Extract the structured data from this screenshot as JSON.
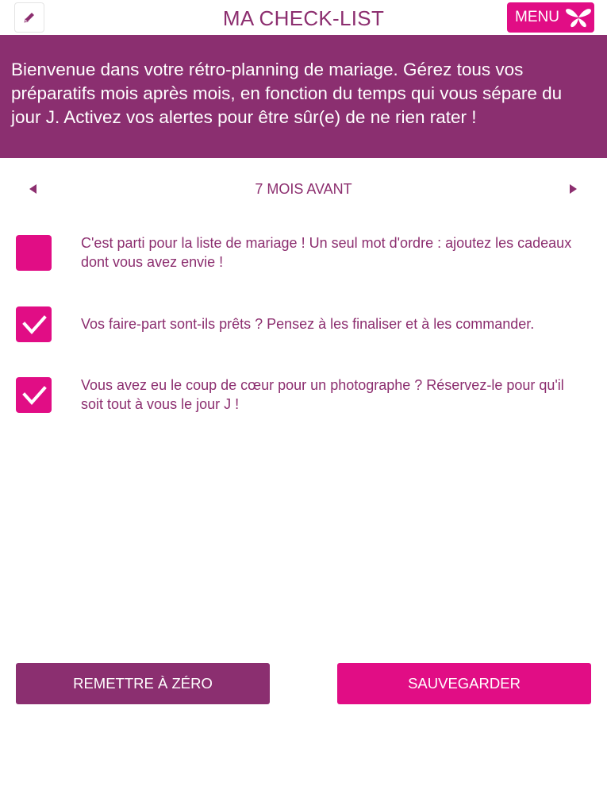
{
  "header": {
    "title": "MA CHECK-LIST",
    "menu_label": "MENU",
    "edit_icon": "pencil-icon",
    "menu_icon": "butterfly-icon"
  },
  "banner": {
    "text": "Bienvenue dans votre rétro-planning de mariage. Gérez tous vos préparatifs mois après mois, en fonction du temps qui vous sépare du jour J. Activez vos alertes pour être sûr(e) de ne rien rater !"
  },
  "month_nav": {
    "label": "7 MOIS AVANT",
    "prev_icon": "triangle-left-icon",
    "next_icon": "triangle-right-icon"
  },
  "tasks": [
    {
      "text": "C'est parti pour la liste de mariage ! Un seul mot d'ordre : ajoutez les cadeaux dont vous avez envie !",
      "checked": false
    },
    {
      "text": "Vos faire-part sont-ils prêts ? Pensez à les finaliser et à les commander.",
      "checked": true
    },
    {
      "text": "Vous avez eu le coup de cœur pour un photographe ? Réservez-le pour qu'il soit tout à vous le jour J !",
      "checked": true
    }
  ],
  "actions": {
    "reset_label": "REMETTRE À ZÉRO",
    "save_label": "SAUVEGARDER"
  },
  "colors": {
    "brand_purple": "#8b2f70",
    "brand_pink": "#e10d85",
    "text_purple": "#8c2e6f"
  }
}
